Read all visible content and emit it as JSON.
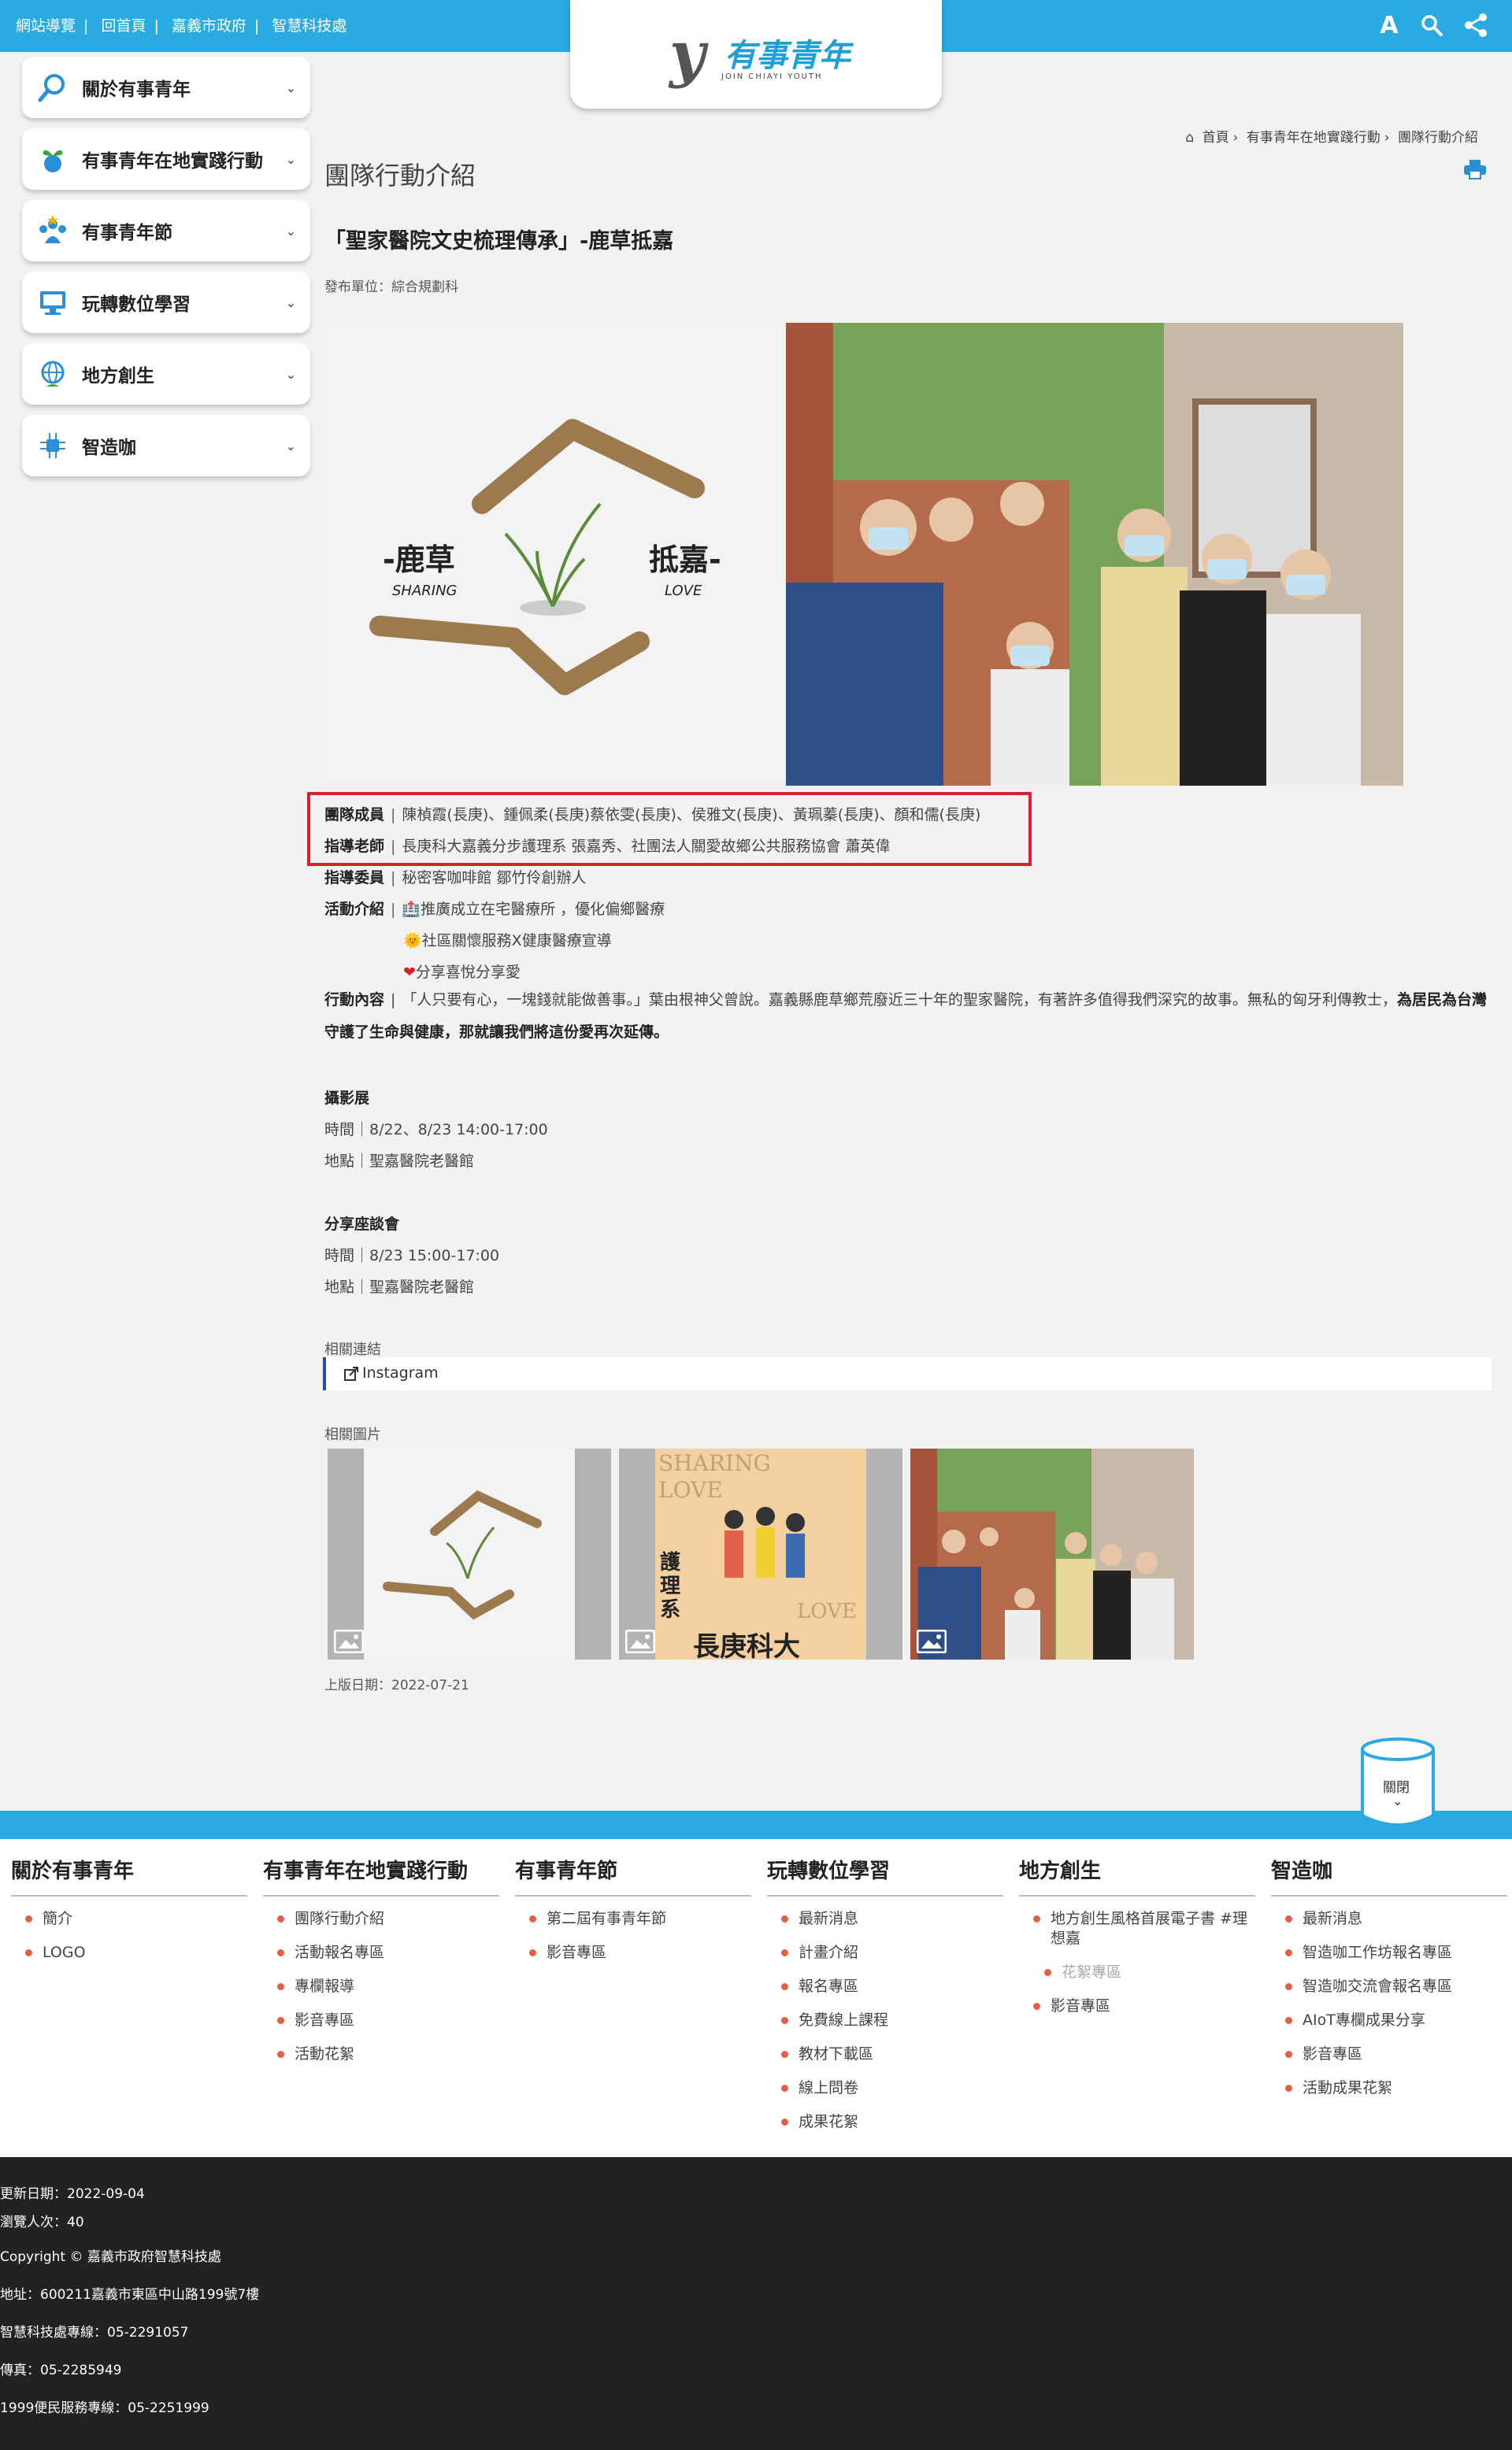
{
  "header": {
    "links": [
      "網站導覽",
      "回首頁",
      "嘉義市政府",
      "智慧科技處"
    ],
    "logo_text": "有事青年",
    "logo_sub": "JOIN CHIAYI YOUTH",
    "font_icon_label": "A"
  },
  "sidebar": {
    "items": [
      {
        "label": "關於有事青年",
        "icon": "search-icon"
      },
      {
        "label": "有事青年在地實踐行動",
        "icon": "sprout-icon"
      },
      {
        "label": "有事青年節",
        "icon": "people-icon"
      },
      {
        "label": "玩轉數位學習",
        "icon": "monitor-icon"
      },
      {
        "label": "地方創生",
        "icon": "globe-icon"
      },
      {
        "label": "智造咖",
        "icon": "chip-icon"
      }
    ]
  },
  "breadcrumb": [
    "首頁",
    "有事青年在地實踐行動",
    "團隊行動介紹"
  ],
  "page_title": "團隊行動介紹",
  "article": {
    "title": "「聖家醫院文史梳理傳承」-鹿草抵嘉",
    "publisher": "發布單位：綜合規劃科",
    "hero_logo_left": "-鹿草",
    "hero_logo_left_en": "SHARING",
    "hero_logo_right": "抵嘉-",
    "hero_logo_right_en": "LOVE",
    "members_label": "團隊成員",
    "members": "陳楨霞(長庚)、鍾佩柔(長庚)蔡依雯(長庚)、侯雅文(長庚)、黃珮蓁(長庚)、顏和儒(長庚)",
    "teacher_label": "指導老師",
    "teacher": "長庚科大嘉義分步護理系 張嘉秀、社團法人關愛故鄉公共服務協會 蕭英偉",
    "committee_label": "指導委員",
    "committee": "秘密客咖啡館 鄒竹伶創辦人",
    "activity_label": "活動介紹",
    "activity_items": [
      "推廣成立在宅醫療所 ，優化偏鄉醫療",
      "社區關懷服務X健康醫療宣導",
      "分享喜悅分享愛"
    ],
    "content_label": "行動內容",
    "content_normal": "「人只要有心，一塊錢就能做善事。」葉由根神父曾說。嘉義縣鹿草鄉荒廢近三十年的聖家醫院，有著許多值得我們深究的故事。無私的匈牙利傳教士，",
    "content_bold": "為居民為台灣守護了生命與健康，那就讓我們將這份愛再次延傳。",
    "exhibit_title": "攝影展",
    "exhibit_time": "時間｜8/22、8/23 14:00-17:00",
    "exhibit_place": "地點｜聖嘉醫院老醫館",
    "talk_title": "分享座談會",
    "talk_time": "時間｜8/23 15:00-17:00",
    "talk_place": "地點｜聖嘉醫院老醫館",
    "related_links_label": "相關連結",
    "related_link": "Instagram",
    "related_images_label": "相關圖片",
    "thumb2_top": "SHARING",
    "thumb2_love": "LOVE",
    "thumb2_dept": "護理系",
    "thumb2_school": "長庚科大",
    "upload_date": "上版日期：2022-07-21"
  },
  "close_button": "關閉",
  "footer_nav": [
    {
      "title": "關於有事青年",
      "items": [
        "簡介",
        "LOGO"
      ]
    },
    {
      "title": "有事青年在地實踐行動",
      "items": [
        "團隊行動介紹",
        "活動報名專區",
        "專欄報導",
        "影音專區",
        "活動花絮"
      ]
    },
    {
      "title": "有事青年節",
      "items": [
        "第二屆有事青年節",
        "影音專區"
      ]
    },
    {
      "title": "玩轉數位學習",
      "items": [
        "最新消息",
        "計畫介紹",
        "報名專區",
        "免費線上課程",
        "教材下載區",
        "線上問卷",
        "成果花絮"
      ]
    },
    {
      "title": "地方創生",
      "items": [
        "地方創生風格首展電子書 #理想嘉",
        "花絮專區",
        "影音專區"
      ]
    },
    {
      "title": "智造咖",
      "items": [
        "最新消息",
        "智造咖工作坊報名專區",
        "智造咖交流會報名專區",
        "AIoT專欄成果分享",
        "影音專區",
        "活動成果花絮"
      ]
    }
  ],
  "footer_info": {
    "updated": "更新日期：2022-09-04",
    "views": "瀏覽人次：40",
    "copyright": "Copyright © 嘉義市政府智慧科技處",
    "address": "地址：600211嘉義市東區中山路199號7樓",
    "hotline": "智慧科技處專線：05-2291057",
    "fax": "傳真：05-2285949",
    "service": "1999便民服務專線：05-2251999"
  },
  "colors": {
    "brand_blue": "#29abe2",
    "highlight_red": "#d71f2e",
    "bullet": "#e0614a"
  }
}
